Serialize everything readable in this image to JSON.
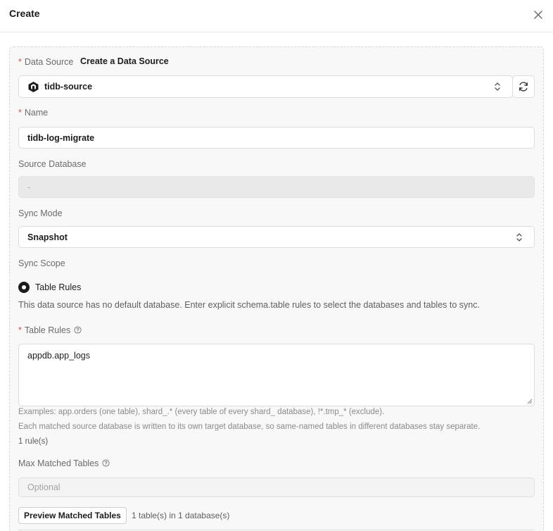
{
  "header": {
    "title": "Create"
  },
  "form": {
    "data_source": {
      "label": "Data Source",
      "create_link": "Create a Data Source",
      "value": "tidb-source"
    },
    "name": {
      "label": "Name",
      "value": "tidb-log-migrate"
    },
    "source_database": {
      "label": "Source Database",
      "value": "-"
    },
    "sync_mode": {
      "label": "Sync Mode",
      "value": "Snapshot"
    },
    "sync_scope": {
      "label": "Sync Scope",
      "option": "Table Rules",
      "description": "This data source has no default database. Enter explicit schema.table rules to select the databases and tables to sync."
    },
    "table_rules": {
      "label": "Table Rules",
      "value": "appdb.app_logs",
      "hint1": "Examples: app.orders (one table), shard_.* (every table of every shard_ database), !*.tmp_* (exclude).",
      "hint2": "Each matched source database is written to its own target database, so same-named tables in different databases stay separate.",
      "count": "1 rule(s)"
    },
    "max_matched_tables": {
      "label": "Max Matched Tables",
      "placeholder": "Optional"
    },
    "preview": {
      "button": "Preview Matched Tables",
      "result": "1 table(s) in 1 database(s)"
    }
  }
}
